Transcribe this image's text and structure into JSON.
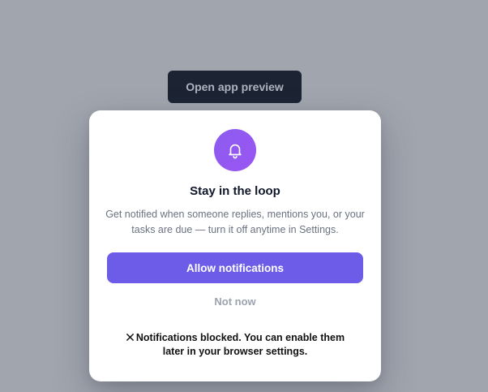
{
  "page": {
    "preview_button_label": "Open app preview"
  },
  "modal": {
    "icon": "bell-icon",
    "title": "Stay in the loop",
    "description": "Get notified when someone replies, mentions you, or your tasks are due — turn it off anytime in Settings.",
    "allow_label": "Allow notifications",
    "dismiss_label": "Not now",
    "status_icon": "close-icon",
    "status_text": "Notifications blocked. You can enable them later in your browser settings."
  },
  "colors": {
    "backdrop": "#a1a5ae",
    "preview_button_bg": "#1c2434",
    "accent": "#6c5ce7",
    "icon_circle": "#9a55f2"
  }
}
